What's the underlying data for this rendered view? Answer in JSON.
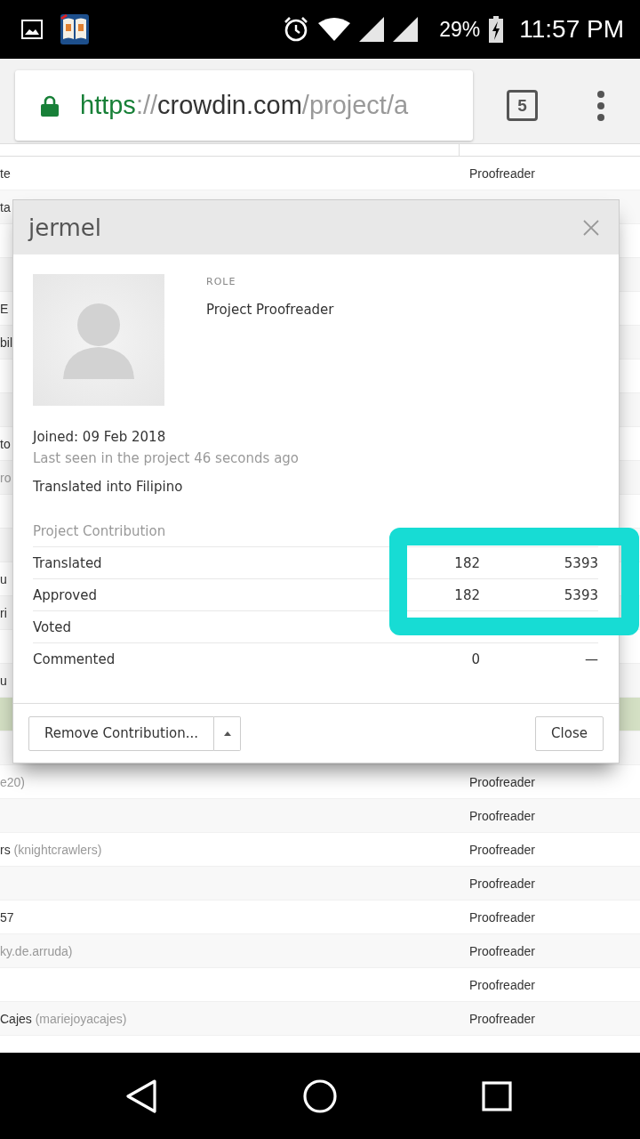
{
  "status_bar": {
    "battery": "29%",
    "time": "11:57 PM"
  },
  "browser": {
    "url": {
      "scheme": "https",
      "separator": "://",
      "host": "crowdin.com",
      "path": "/project/a"
    },
    "tab_count": "5"
  },
  "table": {
    "rows": [
      {
        "name": "te",
        "role": "Proofreader",
        "selected": false
      },
      {
        "name": "ta",
        "selected": false
      },
      {
        "selected": false
      },
      {
        "selected": false
      },
      {
        "name": "E",
        "selected": false
      },
      {
        "name": "bil",
        "selected": false
      },
      {
        "selected": false
      },
      {
        "selected": false
      },
      {
        "name": "to",
        "selected": false
      },
      {
        "username": "ro",
        "selected": false
      },
      {
        "selected": false
      },
      {
        "selected": false
      },
      {
        "name": "u",
        "selected": false
      },
      {
        "name": "ri",
        "selected": false
      },
      {
        "selected": false
      },
      {
        "name": "u",
        "selected": false
      },
      {
        "selected": true
      },
      {
        "selected": false
      },
      {
        "username": "e20)",
        "role": "Proofreader",
        "selected": false
      },
      {
        "role": "Proofreader",
        "selected": false
      },
      {
        "name": "rs",
        "username": "(knightcrawlers)",
        "role": "Proofreader",
        "selected": false
      },
      {
        "role": "Proofreader",
        "selected": false
      },
      {
        "name": "57",
        "role": "Proofreader",
        "selected": false
      },
      {
        "username": "ky.de.arruda)",
        "role": "Proofreader",
        "selected": false
      },
      {
        "role": "Proofreader",
        "selected": false
      },
      {
        "name": "Cajes",
        "username": "(mariejoyacajes)",
        "role": "Proofreader",
        "selected": false
      }
    ]
  },
  "dialog": {
    "title": "jermel",
    "role_label": "ROLE",
    "role": "Project Proofreader",
    "joined": "Joined: 09 Feb 2018",
    "last_seen": "Last seen in the project 46 seconds ago",
    "translated_into": "Translated into Filipino",
    "contribution_title": "Project Contribution",
    "stats": [
      {
        "label": "Translated",
        "value_1": "182",
        "value_2": "5393"
      },
      {
        "label": "Approved",
        "value_1": "182",
        "value_2": "5393"
      },
      {
        "label": "Voted"
      },
      {
        "label": "Commented",
        "value_1": "0",
        "value_2": "—"
      }
    ],
    "buttons": {
      "remove": "Remove Contribution...",
      "close": "Close"
    }
  }
}
